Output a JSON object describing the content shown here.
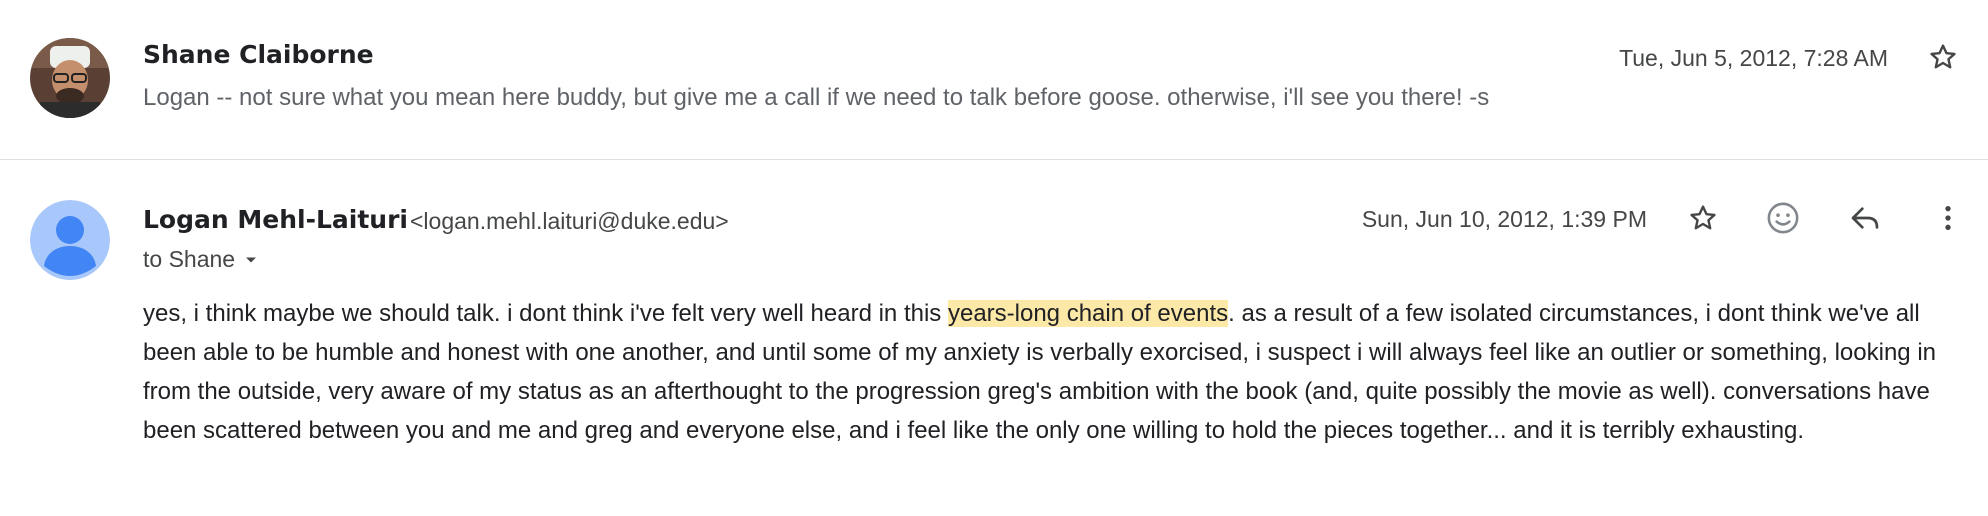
{
  "messages": [
    {
      "sender": "Shane Claiborne",
      "date": "Tue, Jun 5, 2012, 7:28 AM",
      "snippet": "Logan -- not sure what you mean here buddy, but give me a call if we need to talk before goose. otherwise, i'll see you there! -s",
      "avatar_icon": "photo-avatar"
    },
    {
      "sender": "Logan Mehl-Laituri",
      "email": "<logan.mehl.laituri@duke.edu>",
      "date": "Sun, Jun 10, 2012, 1:39 PM",
      "to": "to Shane",
      "avatar_icon": "default-person-avatar",
      "body_before": "yes, i think maybe we should talk. i dont think i've felt very well heard in this ",
      "body_highlight": "years-long chain of events",
      "body_after": ". as a result of a few isolated circumstances, i dont think we've all been able to be humble and honest with one another, and until some of my anxiety is verbally exorcised, i suspect i will always feel like an outlier or something, looking in from the outside, very aware of my status as an afterthought to the progression greg's ambition with the book (and, quite possibly the movie as well). conversations have been scattered between you and me and greg and everyone else, and i feel like the only one willing to hold the pieces together... and it is terribly exhausting."
    }
  ],
  "icons": [
    "star-icon",
    "emoji-react-icon",
    "reply-icon",
    "more-vert-icon",
    "chevron-down-icon"
  ],
  "colors": {
    "highlight": "#fce8a7",
    "default_avatar": "#a8c7fa",
    "default_avatar_figure": "#4285f4",
    "secondary_text": "#5f6368"
  }
}
